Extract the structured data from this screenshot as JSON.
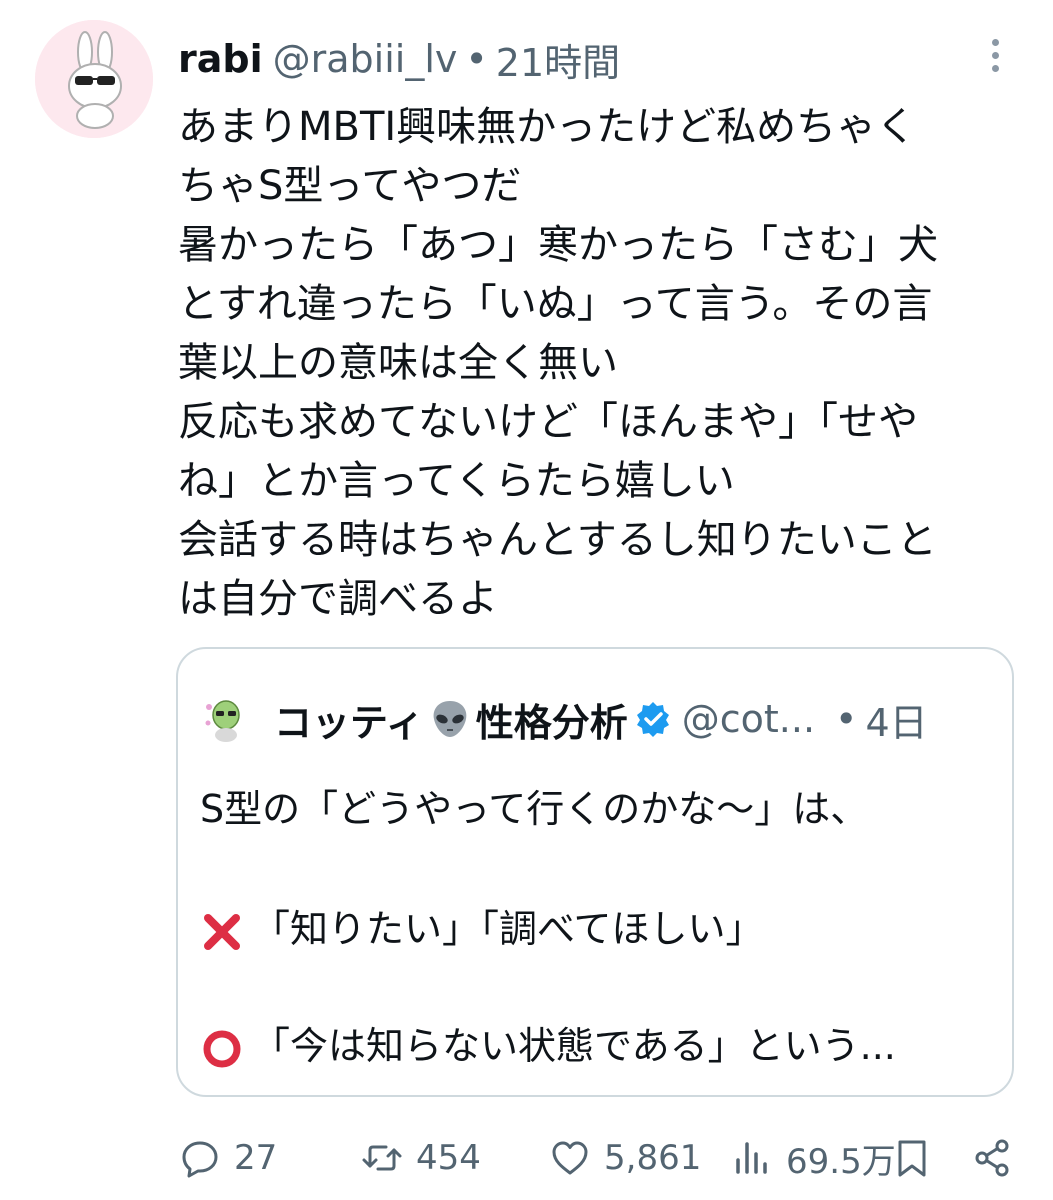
{
  "tweet": {
    "display_name": "rabi",
    "handle": "@rabiii_lv",
    "separator": "•",
    "time": "21時間",
    "avatar_icon": "rabbit-sunglasses-avatar",
    "lines": [
      "あまりMBTI興味無かったけど私めちゃく",
      "ちゃS型ってやつだ",
      "暑かったら「あつ」寒かったら「さむ」犬",
      "とすれ違ったら「いぬ」って言う。その言",
      "葉以上の意味は全く無い",
      "反応も求めてないけど「ほんまや」「せや",
      "ね」とか言ってくらたら嬉しい",
      "会話する時はちゃんとするし知りたいこと",
      "は自分で調べるよ"
    ]
  },
  "quote": {
    "display_name": "コッティ",
    "name_suffix": "性格分析",
    "name_emoji": "alien-emoji",
    "verified_icon": "verified-badge-icon",
    "handle": "@cot...",
    "separator": "•",
    "time": "4日",
    "line1": "S型の「どうやって行くのかな〜」は、",
    "line2": "「知りたい」「調べてほしい」",
    "line3": "「今は知らない状態である」という...",
    "line2_mark": "cross-mark-emoji",
    "line3_mark": "circle-mark-emoji"
  },
  "actions": {
    "replies": "27",
    "reposts": "454",
    "likes": "5,861",
    "views": "69.5万"
  },
  "colors": {
    "text": "#0f1419",
    "secondary": "#536471",
    "border": "#cfd9de",
    "verified": "#1d9bf0",
    "cross": "#dd2e44"
  }
}
